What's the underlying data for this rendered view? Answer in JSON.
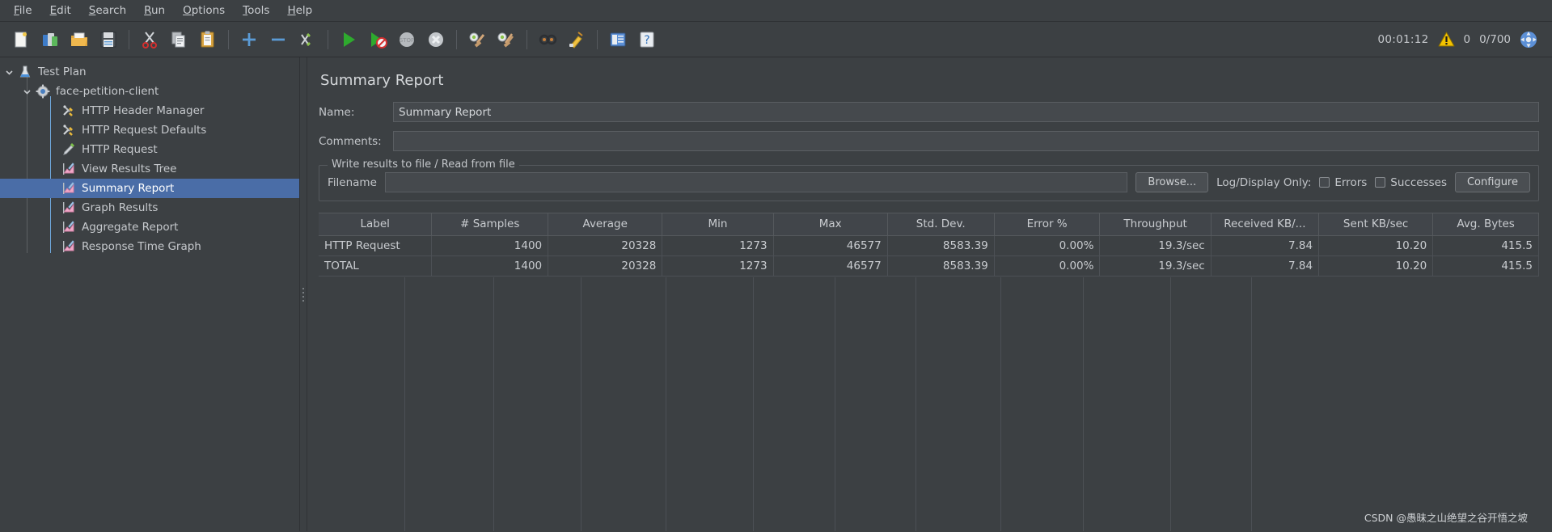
{
  "menubar": {
    "items": [
      {
        "mnemonic": "F",
        "rest": "ile"
      },
      {
        "mnemonic": "E",
        "rest": "dit"
      },
      {
        "mnemonic": "S",
        "rest": "earch"
      },
      {
        "mnemonic": "R",
        "rest": "un"
      },
      {
        "mnemonic": "O",
        "rest": "ptions"
      },
      {
        "mnemonic": "T",
        "rest": "ools"
      },
      {
        "mnemonic": "H",
        "rest": "elp"
      }
    ]
  },
  "toolbar": {
    "buttons": [
      {
        "name": "new-icon"
      },
      {
        "name": "templates-icon"
      },
      {
        "name": "open-icon"
      },
      {
        "name": "save-icon"
      },
      {
        "name": "separator"
      },
      {
        "name": "cut-icon"
      },
      {
        "name": "copy-icon"
      },
      {
        "name": "paste-icon"
      },
      {
        "name": "separator"
      },
      {
        "name": "expand-all-icon"
      },
      {
        "name": "collapse-all-icon"
      },
      {
        "name": "toggle-icon"
      },
      {
        "name": "separator"
      },
      {
        "name": "start-icon"
      },
      {
        "name": "start-no-pauses-icon"
      },
      {
        "name": "stop-icon"
      },
      {
        "name": "shutdown-icon"
      },
      {
        "name": "separator"
      },
      {
        "name": "clear-icon"
      },
      {
        "name": "clear-all-icon"
      },
      {
        "name": "separator"
      },
      {
        "name": "search-icon"
      },
      {
        "name": "search-reset-icon"
      },
      {
        "name": "separator"
      },
      {
        "name": "function-helper-icon"
      },
      {
        "name": "help-icon"
      }
    ]
  },
  "status": {
    "elapsed_time": "00:01:12",
    "warning_count": "0",
    "thread_counts": "0/700",
    "warning_icon": "warning-triangle-icon",
    "connection_icon": "connection-globe-icon"
  },
  "tree": {
    "nodes": [
      {
        "label": "Test Plan",
        "level": 0,
        "icon": "test-plan-icon",
        "expanded": true,
        "selected": false
      },
      {
        "label": "face-petition-client",
        "level": 1,
        "icon": "thread-group-icon",
        "expanded": true,
        "selected": false
      },
      {
        "label": "HTTP Header Manager",
        "level": 2,
        "icon": "config-element-icon",
        "expanded": null,
        "selected": false
      },
      {
        "label": "HTTP Request Defaults",
        "level": 2,
        "icon": "config-element-icon",
        "expanded": null,
        "selected": false
      },
      {
        "label": "HTTP Request",
        "level": 2,
        "icon": "http-sampler-icon",
        "expanded": null,
        "selected": false
      },
      {
        "label": "View Results Tree",
        "level": 2,
        "icon": "listener-chart-icon",
        "expanded": null,
        "selected": false
      },
      {
        "label": "Summary Report",
        "level": 2,
        "icon": "listener-chart-icon",
        "expanded": null,
        "selected": true
      },
      {
        "label": "Graph Results",
        "level": 2,
        "icon": "listener-chart-icon",
        "expanded": null,
        "selected": false
      },
      {
        "label": "Aggregate Report",
        "level": 2,
        "icon": "listener-chart-icon",
        "expanded": null,
        "selected": false
      },
      {
        "label": "Response Time Graph",
        "level": 2,
        "icon": "listener-chart-icon",
        "expanded": null,
        "selected": false
      }
    ]
  },
  "panel": {
    "title": "Summary Report",
    "name_label": "Name:",
    "name_value": "Summary Report",
    "comments_label": "Comments:",
    "comments_value": "",
    "comments_placeholder": "",
    "group_title": "Write results to file / Read from file",
    "filename_label": "Filename",
    "filename_value": "",
    "browse_label": "Browse...",
    "log_display_label": "Log/Display Only:",
    "errors_label": "Errors",
    "errors_checked": false,
    "successes_label": "Successes",
    "successes_checked": false,
    "configure_label": "Configure"
  },
  "table": {
    "columns": [
      "Label",
      "# Samples",
      "Average",
      "Min",
      "Max",
      "Std. Dev.",
      "Error %",
      "Throughput",
      "Received KB/...",
      "Sent KB/sec",
      "Avg. Bytes"
    ],
    "rows": [
      [
        "HTTP Request",
        "1400",
        "20328",
        "1273",
        "46577",
        "8583.39",
        "0.00%",
        "19.3/sec",
        "7.84",
        "10.20",
        "415.5"
      ],
      [
        "TOTAL",
        "1400",
        "20328",
        "1273",
        "46577",
        "8583.39",
        "0.00%",
        "19.3/sec",
        "7.84",
        "10.20",
        "415.5"
      ]
    ]
  },
  "watermark": {
    "text": "CSDN @愚昧之山绝望之谷开悟之坡"
  },
  "colors": {
    "background": "#3c4043",
    "selection": "#4a6da7",
    "text": "#c6c9cd",
    "border": "#55595d"
  }
}
